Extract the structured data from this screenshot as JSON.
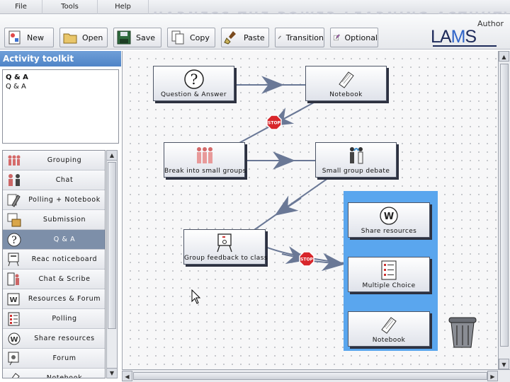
{
  "menu": {
    "items": [
      "File",
      "Tools",
      "Help"
    ]
  },
  "banner": {
    "text": "HARNESS THE POWER   LEARNING ACTIVITY   BASE POTENTIAL"
  },
  "toolbar": {
    "new_label": "New",
    "open_label": "Open",
    "save_label": "Save",
    "copy_label": "Copy",
    "paste_label": "Paste",
    "transition_label": "Transition",
    "optional_label": "Optional"
  },
  "brand": {
    "logo_text": "LAMS",
    "mode_label": "Author"
  },
  "sidebar": {
    "title": "Activity toolkit",
    "info_title": "Q & A",
    "info_description": "Q & A",
    "items": [
      {
        "label": "Grouping",
        "icon": "people-group-icon",
        "selected": false
      },
      {
        "label": "Chat",
        "icon": "chat-icon",
        "selected": false
      },
      {
        "label": "Polling + Notebook",
        "icon": "polling-notebook-icon",
        "selected": false
      },
      {
        "label": "Submission",
        "icon": "submission-icon",
        "selected": false
      },
      {
        "label": "Q & A",
        "icon": "question-mark-icon",
        "selected": true
      },
      {
        "label": "Reac noticeboard",
        "icon": "noticeboard-icon",
        "selected": false
      },
      {
        "label": "Chat & Scribe",
        "icon": "chat-scribe-icon",
        "selected": false
      },
      {
        "label": "Resources & Forum",
        "icon": "resources-forum-icon",
        "selected": false
      },
      {
        "label": "Polling",
        "icon": "polling-icon",
        "selected": false
      },
      {
        "label": "Share resources",
        "icon": "share-resources-icon",
        "selected": false
      },
      {
        "label": "Forum",
        "icon": "forum-icon",
        "selected": false
      },
      {
        "label": "Notebook",
        "icon": "notebook-icon",
        "selected": false
      }
    ]
  },
  "canvas": {
    "activities": {
      "qa": {
        "label": "Question & Answer",
        "icon": "question-mark-icon"
      },
      "notebook1": {
        "label": "Notebook",
        "icon": "notebook-icon"
      },
      "groups": {
        "label": "Break into small groups",
        "icon": "people-group-icon"
      },
      "debate": {
        "label": "Small group debate",
        "icon": "debate-icon"
      },
      "feedback": {
        "label": "Group feedback to class",
        "icon": "presentation-board-icon"
      },
      "share": {
        "label": "Share resources",
        "icon": "share-resources-icon"
      },
      "mcq": {
        "label": "Multiple Choice",
        "icon": "multiple-choice-icon"
      },
      "notebook2": {
        "label": "Notebook",
        "icon": "notebook-icon"
      }
    },
    "stop_gate_text": "STOP",
    "parallel_zone_color": "#5aa6ee",
    "edge_color": "#6a7896"
  }
}
